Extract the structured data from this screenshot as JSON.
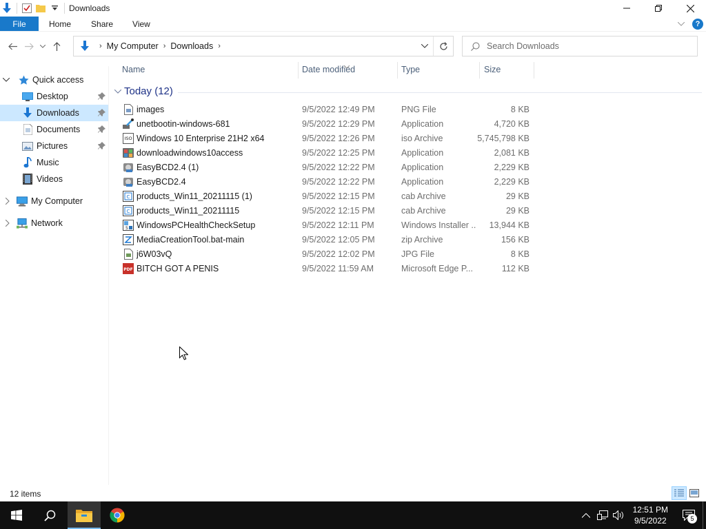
{
  "window": {
    "title": "Downloads",
    "controls": {
      "minimize": "minimize-icon",
      "restore": "restore-icon",
      "close": "close-icon"
    }
  },
  "ribbon": {
    "tabs": [
      "File",
      "Home",
      "Share",
      "View"
    ],
    "help_label": "?"
  },
  "address": {
    "breadcrumbs": [
      "My Computer",
      "Downloads"
    ],
    "search_placeholder": "Search Downloads"
  },
  "nav": {
    "items": [
      {
        "label": "Quick access",
        "icon": "star-icon",
        "expanded": true
      },
      {
        "label": "Desktop",
        "icon": "desktop-icon",
        "pinned": true
      },
      {
        "label": "Downloads",
        "icon": "download-icon",
        "pinned": true,
        "selected": true
      },
      {
        "label": "Documents",
        "icon": "documents-icon",
        "pinned": true
      },
      {
        "label": "Pictures",
        "icon": "pictures-icon",
        "pinned": true
      },
      {
        "label": "Music",
        "icon": "music-icon"
      },
      {
        "label": "Videos",
        "icon": "videos-icon"
      },
      {
        "label": "My Computer",
        "icon": "computer-icon",
        "expanded": false
      },
      {
        "label": "Network",
        "icon": "network-icon",
        "expanded": false
      }
    ]
  },
  "columns": {
    "name": "Name",
    "date": "Date modified",
    "type": "Type",
    "size": "Size"
  },
  "group": {
    "label": "Today (12)"
  },
  "files": [
    {
      "name": "images",
      "date": "9/5/2022 12:49 PM",
      "type": "PNG File",
      "size": "8 KB",
      "icon": "png-file-icon"
    },
    {
      "name": "unetbootin-windows-681",
      "date": "9/5/2022 12:29 PM",
      "type": "Application",
      "size": "4,720 KB",
      "icon": "unetbootin-app-icon"
    },
    {
      "name": "Windows 10 Enterprise 21H2 x64",
      "date": "9/5/2022 12:26 PM",
      "type": "iso Archive",
      "size": "5,745,798 KB",
      "icon": "iso-file-icon"
    },
    {
      "name": "downloadwindows10access",
      "date": "9/5/2022 12:25 PM",
      "type": "Application",
      "size": "2,081 KB",
      "icon": "app-icon"
    },
    {
      "name": "EasyBCD2.4 (1)",
      "date": "9/5/2022 12:22 PM",
      "type": "Application",
      "size": "2,229 KB",
      "icon": "installer-app-icon"
    },
    {
      "name": "EasyBCD2.4",
      "date": "9/5/2022 12:22 PM",
      "type": "Application",
      "size": "2,229 KB",
      "icon": "installer-app-icon"
    },
    {
      "name": "products_Win11_20211115 (1)",
      "date": "9/5/2022 12:15 PM",
      "type": "cab Archive",
      "size": "29 KB",
      "icon": "cab-file-icon"
    },
    {
      "name": "products_Win11_20211115",
      "date": "9/5/2022 12:15 PM",
      "type": "cab Archive",
      "size": "29 KB",
      "icon": "cab-file-icon"
    },
    {
      "name": "WindowsPCHealthCheckSetup",
      "date": "9/5/2022 12:11 PM",
      "type": "Windows Installer ...",
      "size": "13,944 KB",
      "icon": "msi-file-icon"
    },
    {
      "name": "MediaCreationTool.bat-main",
      "date": "9/5/2022 12:05 PM",
      "type": "zip Archive",
      "size": "156 KB",
      "icon": "zip-file-icon"
    },
    {
      "name": "j6W03vQ",
      "date": "9/5/2022 12:02 PM",
      "type": "JPG File",
      "size": "8 KB",
      "icon": "jpg-file-icon"
    },
    {
      "name": "BITCH GOT A PENIS",
      "date": "9/5/2022 11:59 AM",
      "type": "Microsoft Edge P...",
      "size": "112 KB",
      "icon": "pdf-file-icon"
    }
  ],
  "status": {
    "item_count": "12 items"
  },
  "taskbar": {
    "pinned": [
      "start-icon",
      "search-icon",
      "file-explorer-icon",
      "chrome-icon"
    ],
    "clock_time": "12:51 PM",
    "clock_date": "9/5/2022",
    "notification_count": "5"
  },
  "colors": {
    "accent": "#1979ca",
    "selection": "#cce8ff",
    "group_header": "#1e3287",
    "taskbar": "#101010"
  }
}
